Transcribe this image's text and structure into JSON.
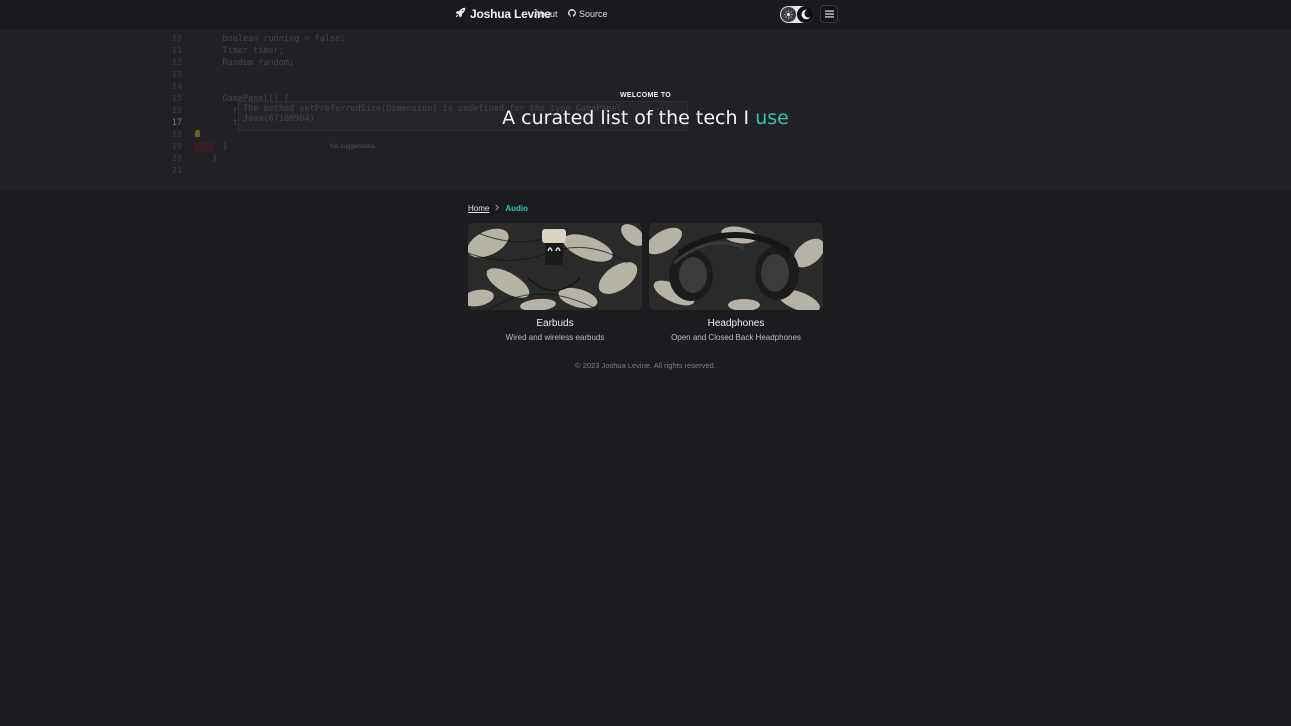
{
  "nav": {
    "brand": "Joshua Levine",
    "about": "About",
    "source": "Source",
    "brand_icon": "rocket-icon",
    "source_icon": "github-icon"
  },
  "hero": {
    "code_lines": [
      {
        "num": "9",
        "text": "    char direction = 'R';"
      },
      {
        "num": "10",
        "text": "    boolean running = false;"
      },
      {
        "num": "11",
        "text": "    Timer timer;"
      },
      {
        "num": "12",
        "text": "    Random random;"
      },
      {
        "num": "13",
        "text": ""
      },
      {
        "num": "14",
        "text": ""
      },
      {
        "num": "15",
        "text": "    GamePanel() {"
      },
      {
        "num": "16",
        "text": "      random = new Random();"
      },
      {
        "num": "17",
        "text": "      this.setPreferredSize(new Dimension(SCREEN_WIDTH, SCREEN_HEIGHT));"
      },
      {
        "num": "18",
        "text": ""
      },
      {
        "num": "19",
        "text": "    }"
      },
      {
        "num": "20",
        "text": "  }"
      },
      {
        "num": "21",
        "text": ""
      }
    ],
    "tooltip": "The method setPreferredSize(Dimension) is undefined for the type GamePanel  Java(67108964)",
    "no_suggestions": "No suggestions.",
    "welcome": "WELCOME TO",
    "headline_prefix": "A curated list of the tech I ",
    "headline_accent": "use"
  },
  "breadcrumb": {
    "home": "Home",
    "current": "Audio"
  },
  "cards": [
    {
      "title": "Earbuds",
      "subtitle": "Wired and wireless earbuds"
    },
    {
      "title": "Headphones",
      "subtitle": "Open and Closed Back Headphones"
    }
  ],
  "footer": "© 2023 Joshua Levine. All rights reserved.",
  "colors": {
    "accent": "#2ec4b0",
    "background": "#1c1b1f",
    "hero_background": "#212026"
  }
}
